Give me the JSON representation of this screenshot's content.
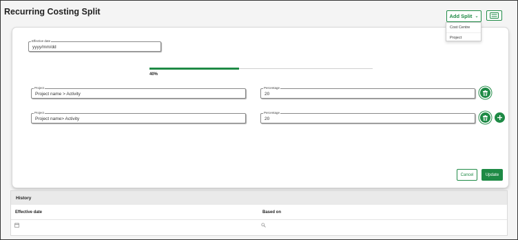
{
  "page": {
    "title": "Recurring Costing Split"
  },
  "toolbar": {
    "add_split_label": "Add Split",
    "add_split_chevron": "⌄",
    "card_toggle_icon": "id-card-icon"
  },
  "add_split_menu": {
    "items": [
      "Cost Centre",
      "Project"
    ]
  },
  "form": {
    "effective_date": {
      "label": "Effective date",
      "value": "yyyy/mm/dd"
    },
    "progress": {
      "value": 0.4,
      "text": "40%"
    },
    "rows": [
      {
        "project_label": "Project",
        "project_value": "Project name > Activity",
        "percentage_label": "Percentage",
        "percentage_value": "20"
      },
      {
        "project_label": "Project",
        "project_value": "Project name> Activity",
        "percentage_label": "Percentage",
        "percentage_value": "20"
      }
    ],
    "cancel_label": "Cancel",
    "update_label": "Update"
  },
  "history": {
    "title": "History",
    "columns": [
      "Effective date",
      "Based on"
    ]
  },
  "colors": {
    "accent": "#1e8a45"
  }
}
